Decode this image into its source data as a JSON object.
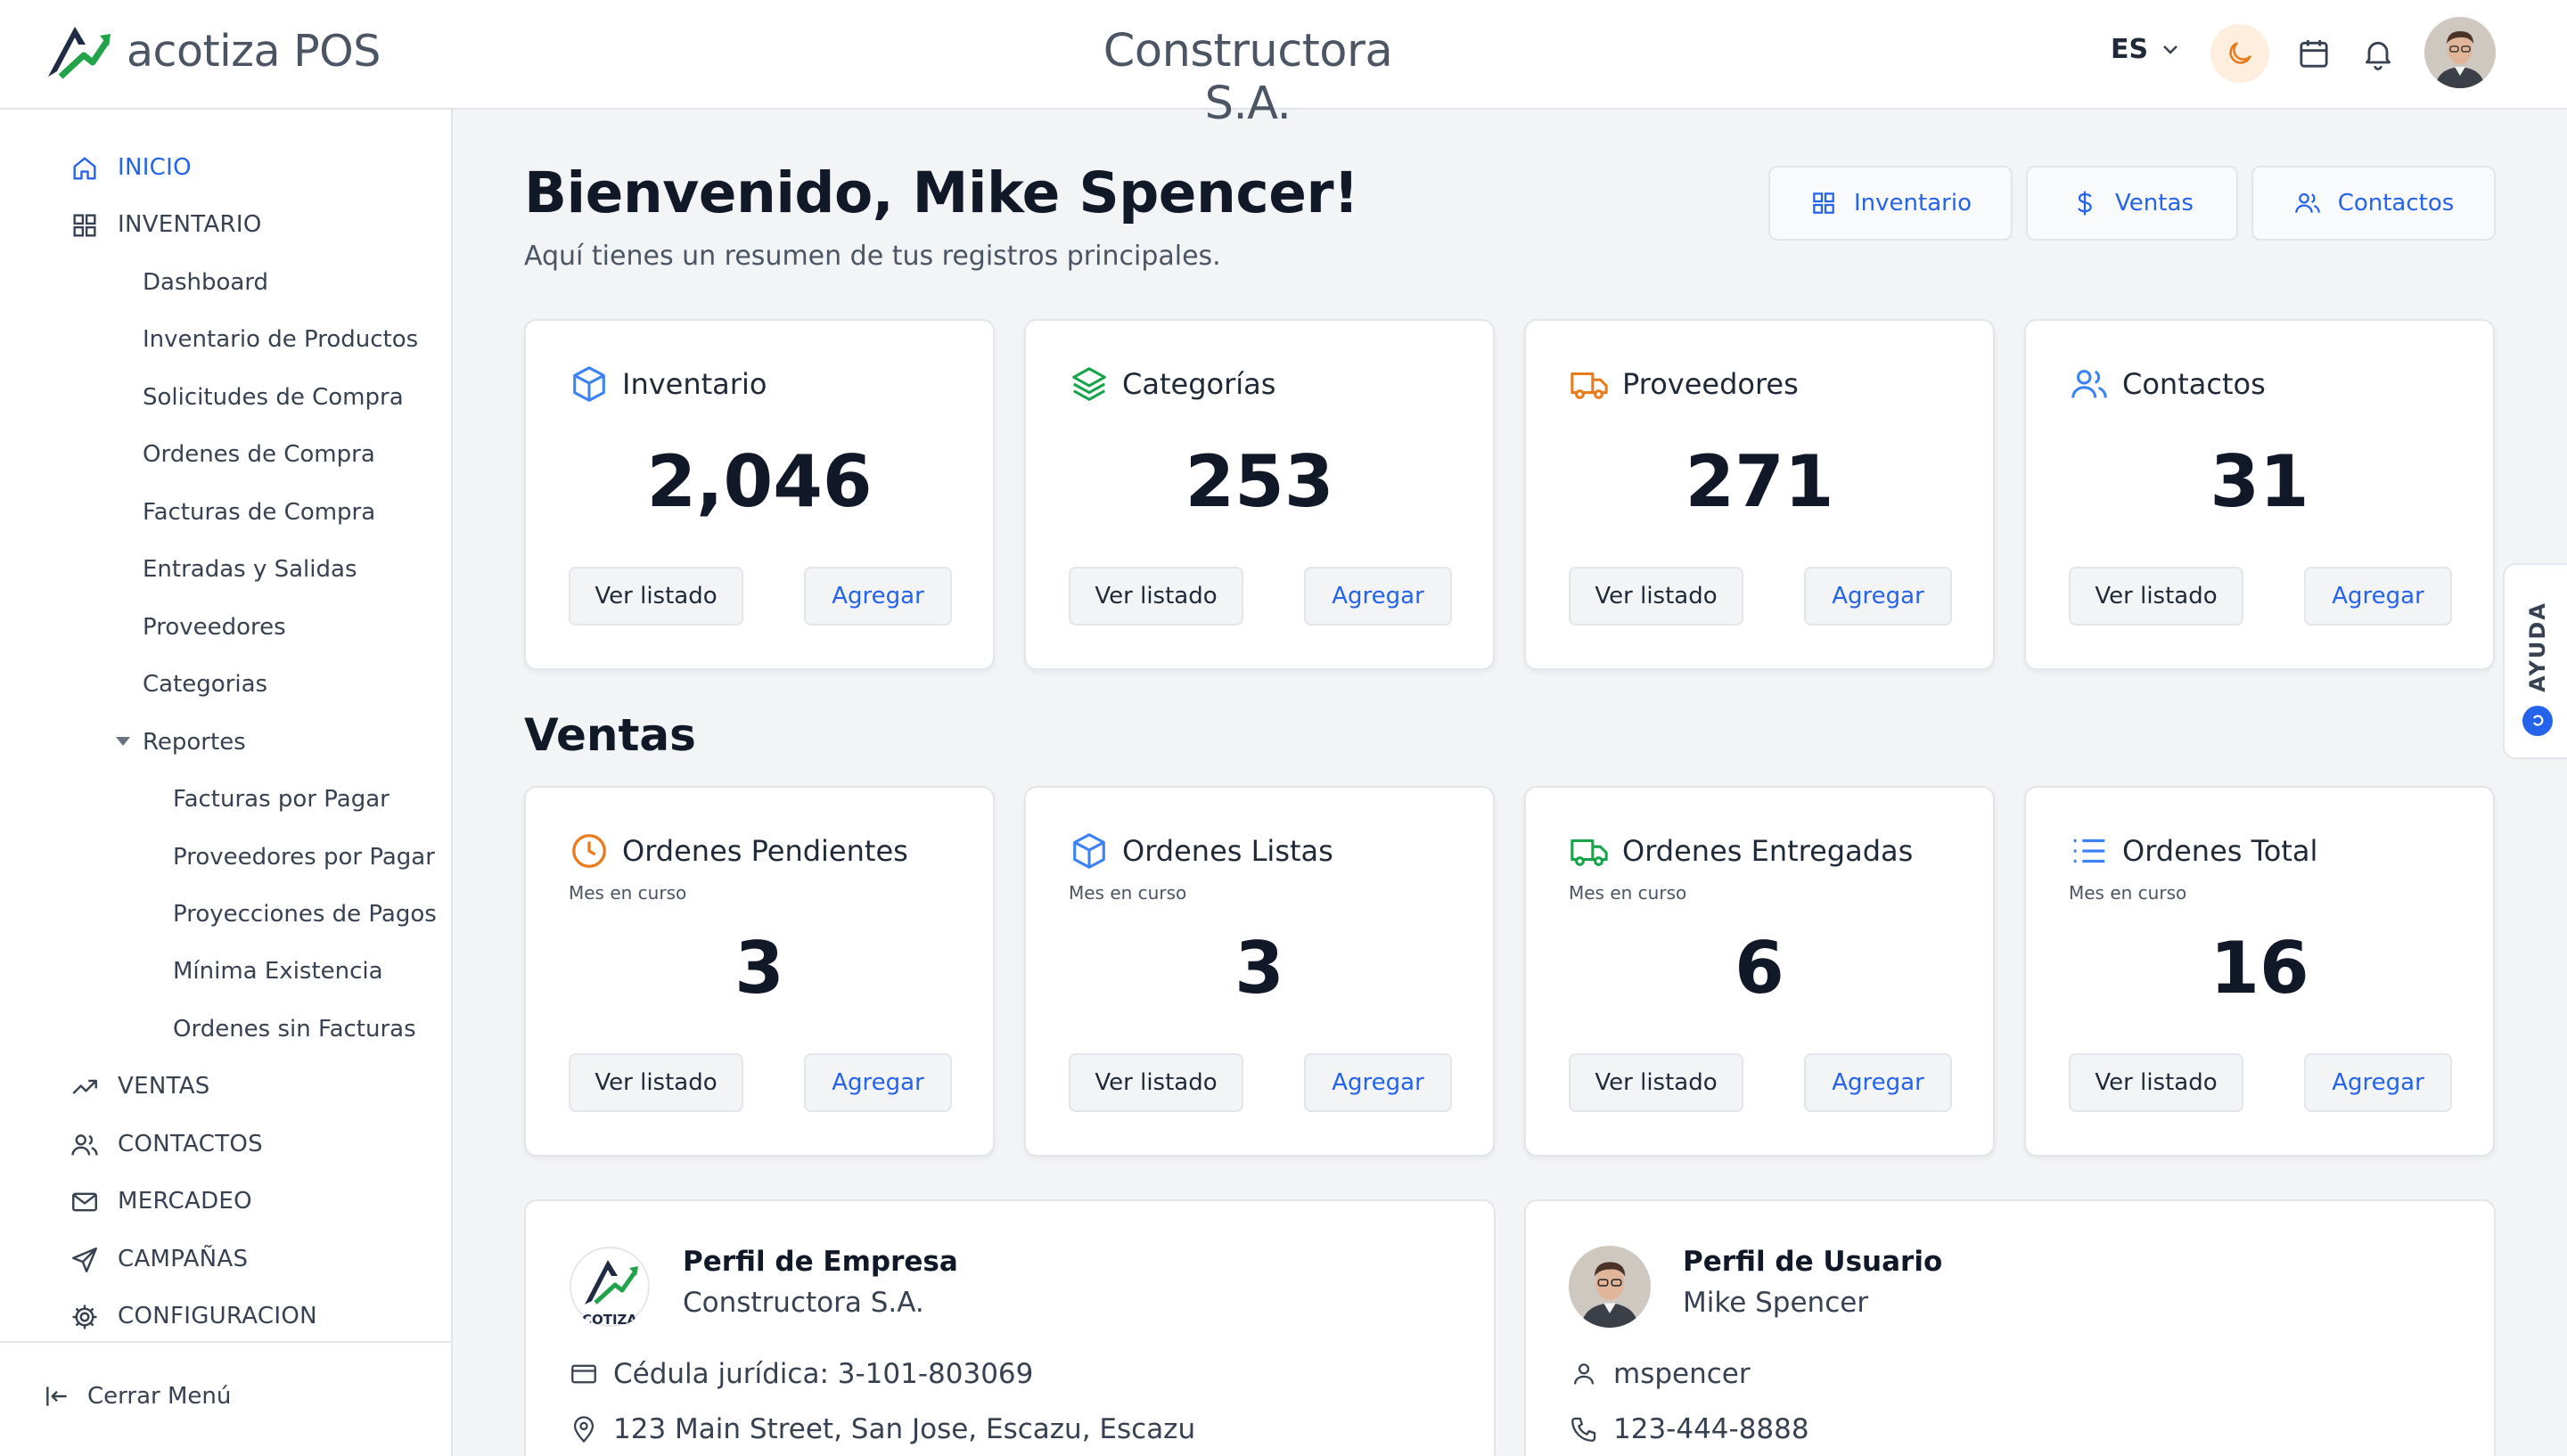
{
  "header": {
    "app_name": "acotiza POS",
    "company": "Constructora S.A.",
    "language": "ES"
  },
  "sidebar": {
    "items": [
      {
        "label": "INICIO",
        "icon": "home-icon",
        "active": true
      },
      {
        "label": "INVENTARIO",
        "icon": "grid-icon"
      },
      {
        "label": "Dashboard"
      },
      {
        "label": "Inventario de Productos"
      },
      {
        "label": "Solicitudes de Compra"
      },
      {
        "label": "Ordenes de Compra"
      },
      {
        "label": "Facturas de Compra"
      },
      {
        "label": "Entradas y Salidas"
      },
      {
        "label": "Proveedores"
      },
      {
        "label": "Categorias"
      },
      {
        "label": "Reportes"
      },
      {
        "label": "Facturas por Pagar"
      },
      {
        "label": "Proveedores por Pagar"
      },
      {
        "label": "Proyecciones de Pagos"
      },
      {
        "label": "Mínima Existencia"
      },
      {
        "label": "Ordenes sin Facturas"
      },
      {
        "label": "VENTAS",
        "icon": "trending-up-icon"
      },
      {
        "label": "CONTACTOS",
        "icon": "users-icon"
      },
      {
        "label": "MERCADEO",
        "icon": "mail-icon"
      },
      {
        "label": "CAMPAÑAS",
        "icon": "send-icon"
      },
      {
        "label": "CONFIGURACION",
        "icon": "gear-icon"
      }
    ],
    "close_menu": "Cerrar Menú"
  },
  "main": {
    "welcome": "Bienvenido, Mike Spencer!",
    "subtitle": "Aquí tienes un resumen de tus registros principales.",
    "quick_links": [
      "Inventario",
      "Ventas",
      "Contactos"
    ],
    "sales_title": "Ventas",
    "buttons": {
      "list": "Ver listado",
      "add": "Agregar"
    },
    "inventory_cards": [
      {
        "title": "Inventario",
        "value": "2,046",
        "icon": "box-icon",
        "color": "#3b82f6"
      },
      {
        "title": "Categorías",
        "value": "253",
        "icon": "layers-icon",
        "color": "#16a34a"
      },
      {
        "title": "Proveedores",
        "value": "271",
        "icon": "truck-icon",
        "color": "#ea7a1a"
      },
      {
        "title": "Contactos",
        "value": "31",
        "icon": "users-icon",
        "color": "#3b82f6"
      }
    ],
    "sales_cards": [
      {
        "title": "Ordenes Pendientes",
        "subtitle": "Mes en curso",
        "value": "3",
        "icon": "clock-icon",
        "color": "#ea7a1a"
      },
      {
        "title": "Ordenes Listas",
        "subtitle": "Mes en curso",
        "value": "3",
        "icon": "box-icon",
        "color": "#3b82f6"
      },
      {
        "title": "Ordenes Entregadas",
        "subtitle": "Mes en curso",
        "value": "6",
        "icon": "truck-icon",
        "color": "#16a34a"
      },
      {
        "title": "Ordenes Total",
        "subtitle": "Mes en curso",
        "value": "16",
        "icon": "list-icon",
        "color": "#3b82f6"
      }
    ],
    "company_profile": {
      "title": "Perfil de Empresa",
      "name": "Constructora S.A.",
      "cedula": "Cédula jurídica: 3-101-803069",
      "address": "123 Main Street, San Jose, Escazu, Escazu",
      "logo_text": "COTIZA"
    },
    "user_profile": {
      "title": "Perfil de Usuario",
      "name": "Mike Spencer",
      "username": "mspencer",
      "phone": "123-444-8888"
    }
  },
  "help": {
    "label": "AYUDA"
  },
  "colors": {
    "accent": "#2563eb",
    "green": "#16a34a",
    "orange": "#ea7a1a"
  }
}
